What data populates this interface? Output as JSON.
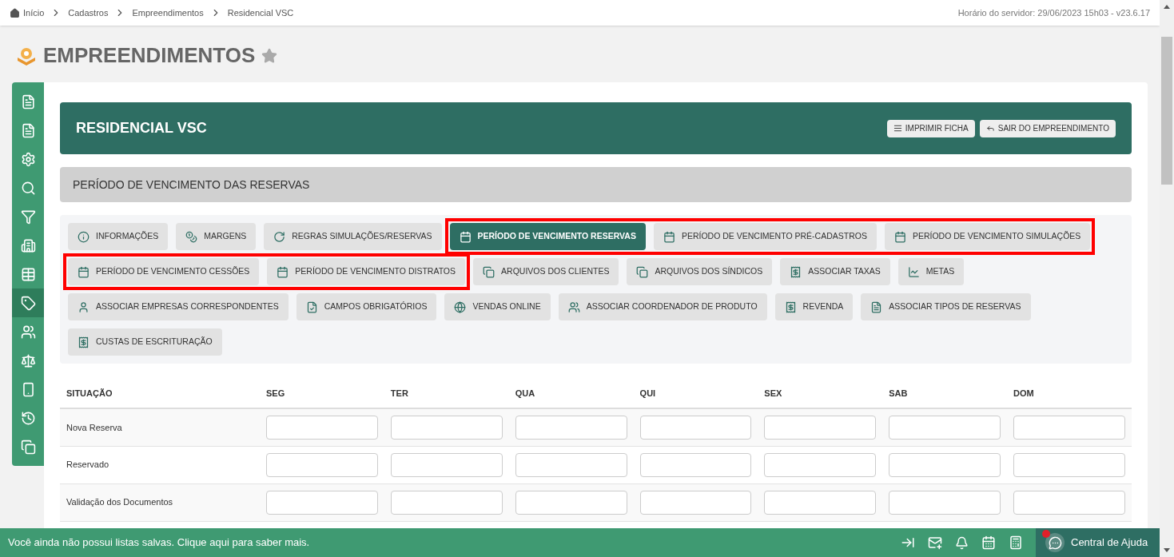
{
  "breadcrumb": [
    {
      "label": "Início"
    },
    {
      "label": "Cadastros"
    },
    {
      "label": "Empreendimentos"
    },
    {
      "label": "Residencial VSC"
    }
  ],
  "server_time": "Horário do servidor: 29/06/2023 15h03 - v23.6.17",
  "page_title": "EMPREENDIMENTOS",
  "favorite": false,
  "sidebar": {
    "items": [
      {
        "selected": false
      },
      {
        "selected": false
      },
      {
        "selected": false
      },
      {
        "selected": false
      },
      {
        "selected": false
      },
      {
        "selected": false
      },
      {
        "selected": false
      },
      {
        "selected": true
      },
      {
        "selected": false
      },
      {
        "selected": false
      },
      {
        "selected": false
      },
      {
        "selected": false
      },
      {
        "selected": false
      }
    ]
  },
  "header": {
    "title": "RESIDENCIAL VSC",
    "buttons": [
      "IMPRIMIR FICHA",
      "SAIR DO EMPREENDIMENTO"
    ]
  },
  "section_title": "PERÍODO DE VENCIMENTO DAS RESERVAS",
  "tab_rows": [
    [
      {
        "label": "INFORMAÇÕES",
        "selected": false,
        "highlighted": false
      },
      {
        "label": "MARGENS",
        "selected": false,
        "highlighted": false
      },
      {
        "label": "REGRAS SIMULAÇÕES/RESERVAS",
        "selected": false,
        "highlighted": false
      },
      {
        "label": "PERÍODO DE VENCIMENTO RESERVAS",
        "selected": true,
        "highlighted": true
      },
      {
        "label": "PERÍODO DE VENCIMENTO PRÉ-CADASTROS",
        "selected": false,
        "highlighted": true
      },
      {
        "label": "PERÍODO DE VENCIMENTO SIMULAÇÕES",
        "selected": false,
        "highlighted": true
      }
    ],
    [
      {
        "label": "PERÍODO DE VENCIMENTO CESSÕES",
        "selected": false,
        "highlighted": true
      },
      {
        "label": "PERÍODO DE VENCIMENTO DISTRATOS",
        "selected": false,
        "highlighted": true
      },
      {
        "label": "ARQUIVOS DOS CLIENTES",
        "selected": false,
        "highlighted": false
      },
      {
        "label": "ARQUIVOS DOS SÍNDICOS",
        "selected": false,
        "highlighted": false
      },
      {
        "label": "ASSOCIAR TAXAS",
        "selected": false,
        "highlighted": false
      },
      {
        "label": "METAS",
        "selected": false,
        "highlighted": false
      }
    ],
    [
      {
        "label": "ASSOCIAR EMPRESAS CORRESPONDENTES",
        "selected": false,
        "highlighted": false
      },
      {
        "label": "CAMPOS OBRIGATÓRIOS",
        "selected": false,
        "highlighted": false
      },
      {
        "label": "VENDAS ONLINE",
        "selected": false,
        "highlighted": false
      },
      {
        "label": "ASSOCIAR COORDENADOR DE PRODUTO",
        "selected": false,
        "highlighted": false
      },
      {
        "label": "REVENDA",
        "selected": false,
        "highlighted": false
      },
      {
        "label": "ASSOCIAR TIPOS DE RESERVAS",
        "selected": false,
        "highlighted": false
      }
    ],
    [
      {
        "label": "CUSTAS DE ESCRITURAÇÃO",
        "selected": false,
        "highlighted": false
      }
    ]
  ],
  "table": {
    "columns": [
      "SITUAÇÃO",
      "SEG",
      "TER",
      "QUA",
      "QUI",
      "SEX",
      "SAB",
      "DOM"
    ],
    "rows": [
      {
        "label": "Nova Reserva"
      },
      {
        "label": "Reservado"
      },
      {
        "label": "Validação dos Documentos"
      }
    ]
  },
  "footer": {
    "message": "Você ainda não possui listas salvas. Clique aqui para saber mais.",
    "notification_dot": true,
    "help": "Central de Ajuda"
  }
}
